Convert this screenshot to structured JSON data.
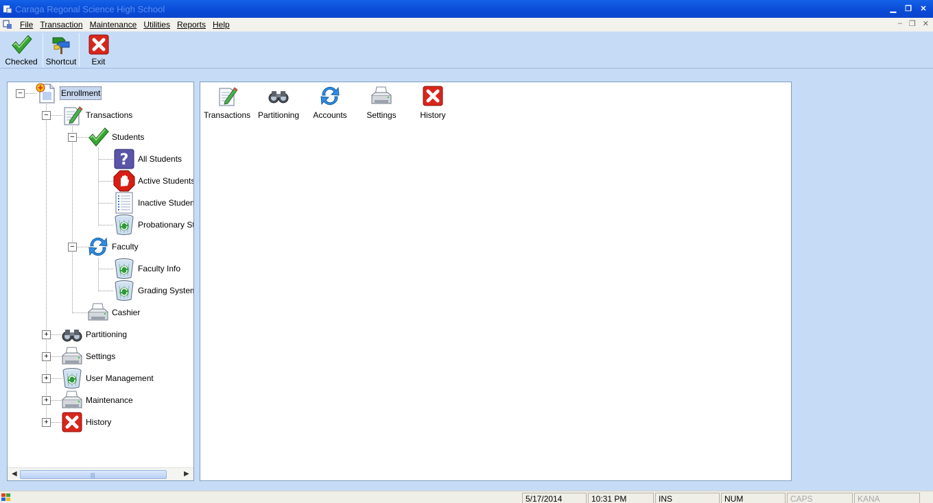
{
  "window": {
    "title": "Caraga Regonal Science High School"
  },
  "menu": {
    "items": [
      {
        "label": "File"
      },
      {
        "label": "Transaction"
      },
      {
        "label": "Maintenance"
      },
      {
        "label": "Utilities"
      },
      {
        "label": "Reports"
      },
      {
        "label": "Help"
      }
    ]
  },
  "toolbar": {
    "checked_label": "Checked",
    "shortcut_label": "Shortcut",
    "exit_label": "Exit"
  },
  "tree": {
    "enrollment": "Enrollment",
    "transactions": "Transactions",
    "students": "Students",
    "all_students": "All Students",
    "active_students": "Active Students",
    "inactive_students": "Inactive Students",
    "probationary_students": "Probationary Students",
    "faculty": "Faculty",
    "faculty_info": "Faculty Info",
    "grading_system": "Grading System",
    "cashier": "Cashier",
    "partitioning": "Partitioning",
    "settings": "Settings",
    "user_management": "User Management",
    "maintenance": "Maintenance",
    "history": "History",
    "scroll_grip": "|||"
  },
  "listview": {
    "items": [
      {
        "label": "Transactions",
        "icon": "edit-document-icon"
      },
      {
        "label": "Partitioning",
        "icon": "binoculars-icon"
      },
      {
        "label": "Accounts",
        "icon": "refresh-icon"
      },
      {
        "label": "Settings",
        "icon": "printer-icon"
      },
      {
        "label": "History",
        "icon": "red-x-icon"
      }
    ]
  },
  "statusbar": {
    "date": "5/17/2014",
    "time": "10:31 PM",
    "ins": "INS",
    "num": "NUM",
    "caps": "CAPS",
    "kana": "KANA"
  },
  "colors": {
    "titlebar": "#0a4ad6",
    "background": "#c6dcf6",
    "selection": "#c7d7ef"
  }
}
